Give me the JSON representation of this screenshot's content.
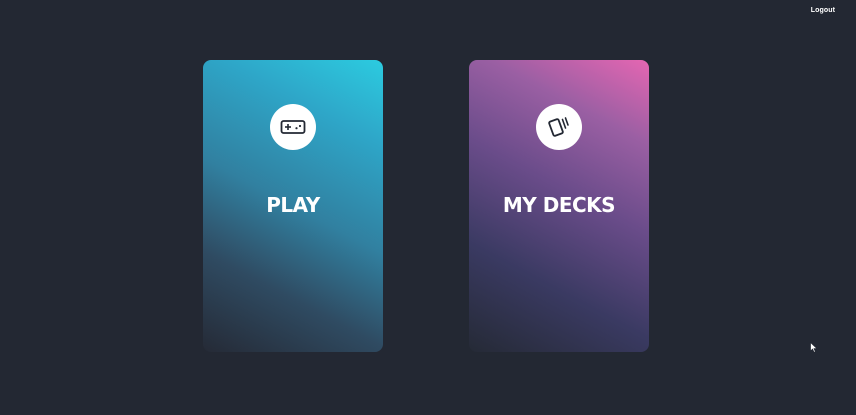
{
  "header": {
    "logout_label": "Logout"
  },
  "cards": [
    {
      "title": "PLAY",
      "icon": "gamepad-icon"
    },
    {
      "title": "MY DECKS",
      "icon": "cards-icon"
    }
  ],
  "colors": {
    "background": "#232833",
    "play_gradient_start": "#2ccbe0",
    "decks_gradient_start": "#e566b2"
  }
}
